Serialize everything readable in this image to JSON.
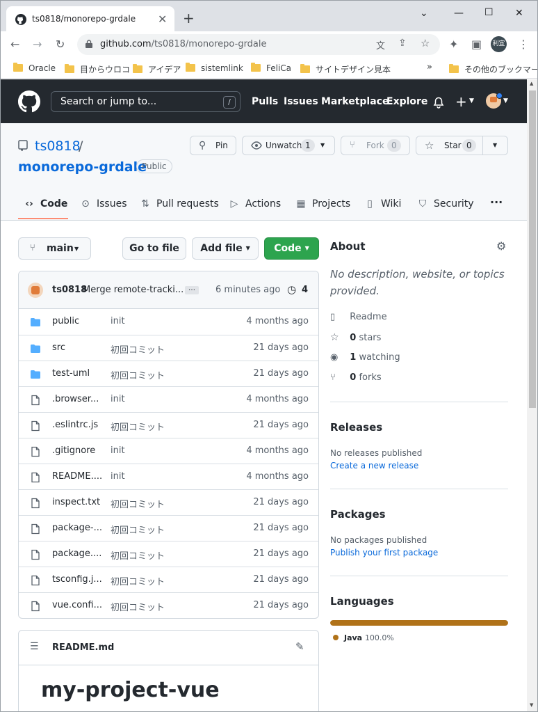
{
  "browser": {
    "tab_title": "ts0818/monorepo-grdale",
    "url_host": "github.com",
    "url_path": "/ts0818/monorepo-grdale",
    "profile_label": "利宜",
    "bookmarks": [
      "Oracle",
      "目からウロコ",
      "アイデア",
      "sistemlink",
      "FeliCa",
      "サイトデザイン見本"
    ],
    "other_bookmarks": "その他のブックマーク"
  },
  "gh": {
    "search_placeholder": "Search or jump to...",
    "search_key": "/",
    "nav": [
      "Pulls",
      "Issues",
      "Marketplace",
      "Explore"
    ]
  },
  "repo": {
    "owner": "ts0818",
    "name": "monorepo-grdale",
    "visibility": "Public",
    "pin_label": "Pin",
    "watch_label": "Unwatch",
    "watch_count": "1",
    "fork_label": "Fork",
    "fork_count": "0",
    "star_label": "Star",
    "star_count": "0",
    "tabs": [
      "Code",
      "Issues",
      "Pull requests",
      "Actions",
      "Projects",
      "Wiki",
      "Security"
    ],
    "more": "···"
  },
  "toolbar": {
    "branch": "main",
    "go_to_file": "Go to file",
    "add_file": "Add file",
    "code": "Code"
  },
  "commit": {
    "author": "ts0818",
    "message": "Merge remote-tracki...",
    "ellipsis": "…",
    "time": "6 minutes ago",
    "count": "4"
  },
  "files": [
    {
      "name": "public",
      "type": "dir",
      "msg": "init",
      "age": "4 months ago"
    },
    {
      "name": "src",
      "type": "dir",
      "msg": "初回コミット",
      "age": "21 days ago"
    },
    {
      "name": "test-uml",
      "type": "dir",
      "msg": "初回コミット",
      "age": "21 days ago"
    },
    {
      "name": ".browser...",
      "type": "file",
      "msg": "init",
      "age": "4 months ago"
    },
    {
      "name": ".eslintrc.js",
      "type": "file",
      "msg": "初回コミット",
      "age": "21 days ago"
    },
    {
      "name": ".gitignore",
      "type": "file",
      "msg": "init",
      "age": "4 months ago"
    },
    {
      "name": "README....",
      "type": "file",
      "msg": "init",
      "age": "4 months ago"
    },
    {
      "name": "inspect.txt",
      "type": "file",
      "msg": "初回コミット",
      "age": "21 days ago"
    },
    {
      "name": "package-...",
      "type": "file",
      "msg": "初回コミット",
      "age": "21 days ago"
    },
    {
      "name": "package....",
      "type": "file",
      "msg": "初回コミット",
      "age": "21 days ago"
    },
    {
      "name": "tsconfig.j...",
      "type": "file",
      "msg": "初回コミット",
      "age": "21 days ago"
    },
    {
      "name": "vue.confi...",
      "type": "file",
      "msg": "初回コミット",
      "age": "21 days ago"
    }
  ],
  "readme": {
    "filename": "README.md",
    "heading": "my-project-vue"
  },
  "about": {
    "title": "About",
    "description": "No description, website, or topics provided.",
    "readme": "Readme",
    "stars_num": "0",
    "stars_label": "stars",
    "watching_num": "1",
    "watching_label": "watching",
    "forks_num": "0",
    "forks_label": "forks"
  },
  "releases": {
    "title": "Releases",
    "none": "No releases published",
    "link": "Create a new release"
  },
  "packages": {
    "title": "Packages",
    "none": "No packages published",
    "link": "Publish your first package"
  },
  "languages": {
    "title": "Languages",
    "items": [
      {
        "name": "Java",
        "percent": "100.0%",
        "color": "#b07219",
        "fraction": 1.0
      }
    ]
  },
  "colors": {
    "accent_link": "#0969da",
    "code_button": "#2da44e",
    "header_bg": "#24292f",
    "folder": "#54aeff",
    "tab_underline": "#fd8c73"
  }
}
